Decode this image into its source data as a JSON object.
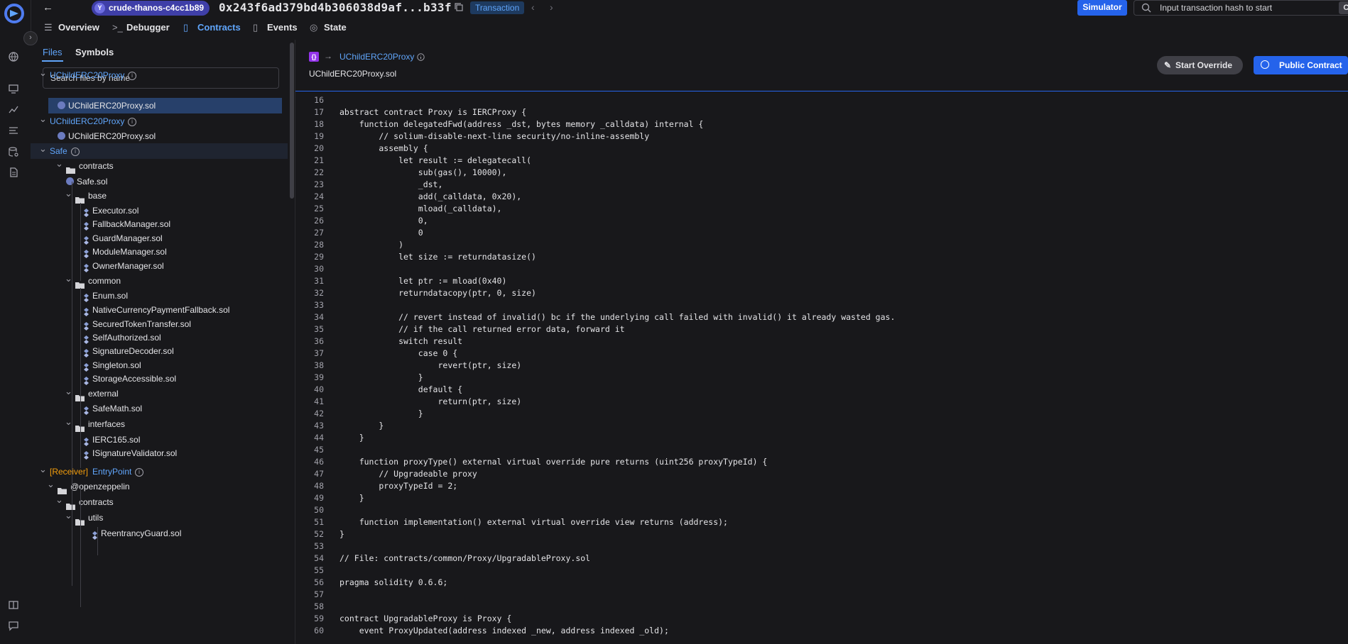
{
  "topbar": {
    "network": "crude-thanos-c4cc1b89",
    "hash": "0x243f6ad379bd4b306038d9af...b33f",
    "type": "Transaction",
    "simulator": "Simulator",
    "search_placeholder": "Input transaction hash to start",
    "shortcut": "Ctrl + k"
  },
  "tabs": [
    {
      "label": "Overview"
    },
    {
      "label": "Debugger"
    },
    {
      "label": "Contracts"
    },
    {
      "label": "Events"
    },
    {
      "label": "State"
    }
  ],
  "panel": {
    "tabs": [
      "Files",
      "Symbols"
    ],
    "search_placeholder": "Search files by name",
    "tree": [
      {
        "label": "UChildERC20Proxy"
      },
      {
        "label": "UChildERC20Proxy.sol"
      },
      {
        "label": "UChildERC20Proxy"
      },
      {
        "label": "UChildERC20Proxy.sol"
      },
      {
        "label": "Safe"
      },
      {
        "label": "contracts"
      },
      {
        "label": "Safe.sol"
      },
      {
        "label": "base"
      },
      {
        "label": "Executor.sol"
      },
      {
        "label": "FallbackManager.sol"
      },
      {
        "label": "GuardManager.sol"
      },
      {
        "label": "ModuleManager.sol"
      },
      {
        "label": "OwnerManager.sol"
      },
      {
        "label": "common"
      },
      {
        "label": "Enum.sol"
      },
      {
        "label": "NativeCurrencyPaymentFallback.sol"
      },
      {
        "label": "SecuredTokenTransfer.sol"
      },
      {
        "label": "SelfAuthorized.sol"
      },
      {
        "label": "SignatureDecoder.sol"
      },
      {
        "label": "Singleton.sol"
      },
      {
        "label": "StorageAccessible.sol"
      },
      {
        "label": "external"
      },
      {
        "label": "SafeMath.sol"
      },
      {
        "label": "interfaces"
      },
      {
        "label": "IERC165.sol"
      },
      {
        "label": "ISignatureValidator.sol"
      },
      {
        "label": "EntryPoint",
        "prefix": "[Receiver]"
      },
      {
        "label": "@openzeppelin"
      },
      {
        "label": "contracts"
      },
      {
        "label": "utils"
      },
      {
        "label": "ReentrancyGuard.sol"
      }
    ]
  },
  "editor": {
    "contract": "UChildERC20Proxy",
    "file": "UChildERC20Proxy.sol",
    "start_override": "Start Override",
    "public_contract": "Public Contract",
    "lines": [
      {
        "n": "16",
        "t": ""
      },
      {
        "n": "17",
        "t": "abstract contract Proxy is IERCProxy {"
      },
      {
        "n": "18",
        "t": "    function delegatedFwd(address _dst, bytes memory _calldata) internal {"
      },
      {
        "n": "19",
        "t": "        // solium-disable-next-line security/no-inline-assembly"
      },
      {
        "n": "20",
        "t": "        assembly {"
      },
      {
        "n": "21",
        "t": "            let result := delegatecall("
      },
      {
        "n": "22",
        "t": "                sub(gas(), 10000),"
      },
      {
        "n": "23",
        "t": "                _dst,"
      },
      {
        "n": "24",
        "t": "                add(_calldata, 0x20),"
      },
      {
        "n": "25",
        "t": "                mload(_calldata),"
      },
      {
        "n": "26",
        "t": "                0,"
      },
      {
        "n": "27",
        "t": "                0"
      },
      {
        "n": "28",
        "t": "            )"
      },
      {
        "n": "29",
        "t": "            let size := returndatasize()"
      },
      {
        "n": "30",
        "t": ""
      },
      {
        "n": "31",
        "t": "            let ptr := mload(0x40)"
      },
      {
        "n": "32",
        "t": "            returndatacopy(ptr, 0, size)"
      },
      {
        "n": "33",
        "t": ""
      },
      {
        "n": "34",
        "t": "            // revert instead of invalid() bc if the underlying call failed with invalid() it already wasted gas."
      },
      {
        "n": "35",
        "t": "            // if the call returned error data, forward it"
      },
      {
        "n": "36",
        "t": "            switch result"
      },
      {
        "n": "37",
        "t": "                case 0 {"
      },
      {
        "n": "38",
        "t": "                    revert(ptr, size)"
      },
      {
        "n": "39",
        "t": "                }"
      },
      {
        "n": "40",
        "t": "                default {"
      },
      {
        "n": "41",
        "t": "                    return(ptr, size)"
      },
      {
        "n": "42",
        "t": "                }"
      },
      {
        "n": "43",
        "t": "        }"
      },
      {
        "n": "44",
        "t": "    }"
      },
      {
        "n": "45",
        "t": ""
      },
      {
        "n": "46",
        "t": "    function proxyType() external virtual override pure returns (uint256 proxyTypeId) {"
      },
      {
        "n": "47",
        "t": "        // Upgradeable proxy"
      },
      {
        "n": "48",
        "t": "        proxyTypeId = 2;"
      },
      {
        "n": "49",
        "t": "    }"
      },
      {
        "n": "50",
        "t": ""
      },
      {
        "n": "51",
        "t": "    function implementation() external virtual override view returns (address);"
      },
      {
        "n": "52",
        "t": "}"
      },
      {
        "n": "53",
        "t": ""
      },
      {
        "n": "54",
        "t": "// File: contracts/common/Proxy/UpgradableProxy.sol"
      },
      {
        "n": "55",
        "t": ""
      },
      {
        "n": "56",
        "t": "pragma solidity 0.6.6;"
      },
      {
        "n": "57",
        "t": ""
      },
      {
        "n": "58",
        "t": ""
      },
      {
        "n": "59",
        "t": "contract UpgradableProxy is Proxy {"
      },
      {
        "n": "60",
        "t": "    event ProxyUpdated(address indexed _new, address indexed _old);"
      }
    ]
  }
}
